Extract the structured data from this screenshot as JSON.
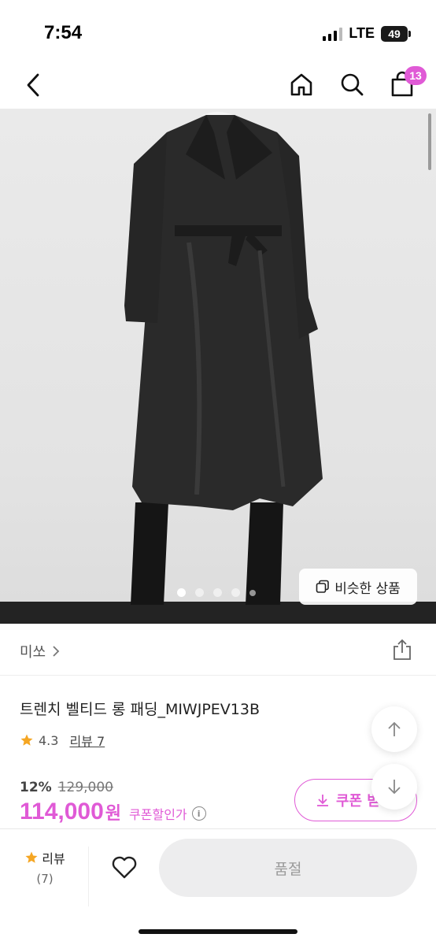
{
  "status_bar": {
    "time": "7:54",
    "network": "LTE",
    "battery": "49"
  },
  "nav": {
    "back_icon": "chevron-left-icon",
    "home_icon": "home-icon",
    "search_icon": "search-icon",
    "cart_icon": "shopping-bag-icon",
    "cart_count": "13"
  },
  "gallery": {
    "similar_button_label": "비슷한 상품",
    "slide_count": 5,
    "active_slide": 1
  },
  "brand": {
    "name": "미쏘",
    "chevron": "›"
  },
  "product": {
    "title": "트렌치 벨티드 롱 패딩_MIWJPEV13B",
    "rating": "4.3",
    "review_link": "리뷰 7",
    "discount_rate": "12%",
    "original_price": "129,000",
    "sale_price": "114,000",
    "currency": "원",
    "coupon_price_label": "쿠폰할인가",
    "coupon_button_label": "쿠폰 받"
  },
  "bottom_bar": {
    "review_label": "리뷰",
    "review_count": "(7)",
    "soldout_label": "품절"
  },
  "colors": {
    "accent": "#e05ad6",
    "star": "#f5a623"
  }
}
